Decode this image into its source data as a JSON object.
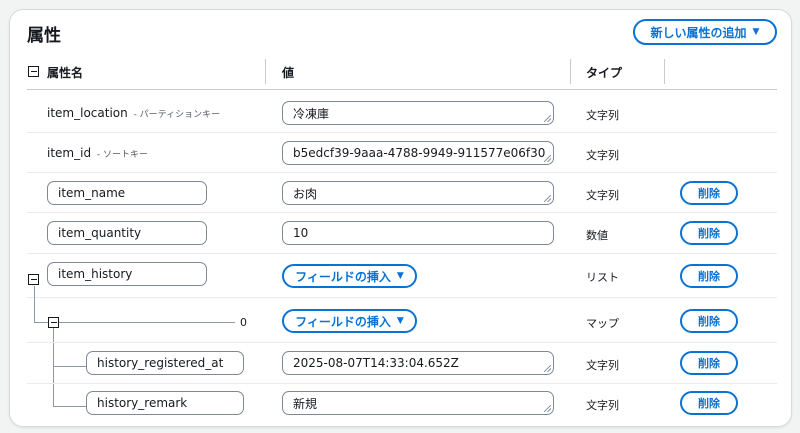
{
  "panel": {
    "title": "属性",
    "add_button_label": "新しい属性の追加",
    "accent_color": "#0972d3"
  },
  "table": {
    "headers": {
      "name": "属性名",
      "value": "値",
      "type": "タイプ"
    },
    "delete_label": "削除",
    "insert_field_label": "フィールドの挿入",
    "rows": [
      {
        "key": "item_location",
        "key_sub": "- パーティションキー",
        "value": "冷凍庫",
        "type": "文字列"
      },
      {
        "key": "item_id",
        "key_sub": "- ソートキー",
        "value": "b5edcf39-9aaa-4788-9949-911577e06f30",
        "type": "文字列"
      },
      {
        "key": "item_name",
        "value": "お肉",
        "type": "文字列"
      },
      {
        "key": "item_quantity",
        "value": "10",
        "type": "数値"
      },
      {
        "key": "item_history",
        "type": "リスト"
      },
      {
        "index": "0",
        "type": "マップ"
      },
      {
        "key": "history_registered_at",
        "value": "2025-08-07T14:33:04.652Z",
        "type": "文字列"
      },
      {
        "key": "history_remark",
        "value": "新規",
        "type": "文字列"
      }
    ]
  }
}
